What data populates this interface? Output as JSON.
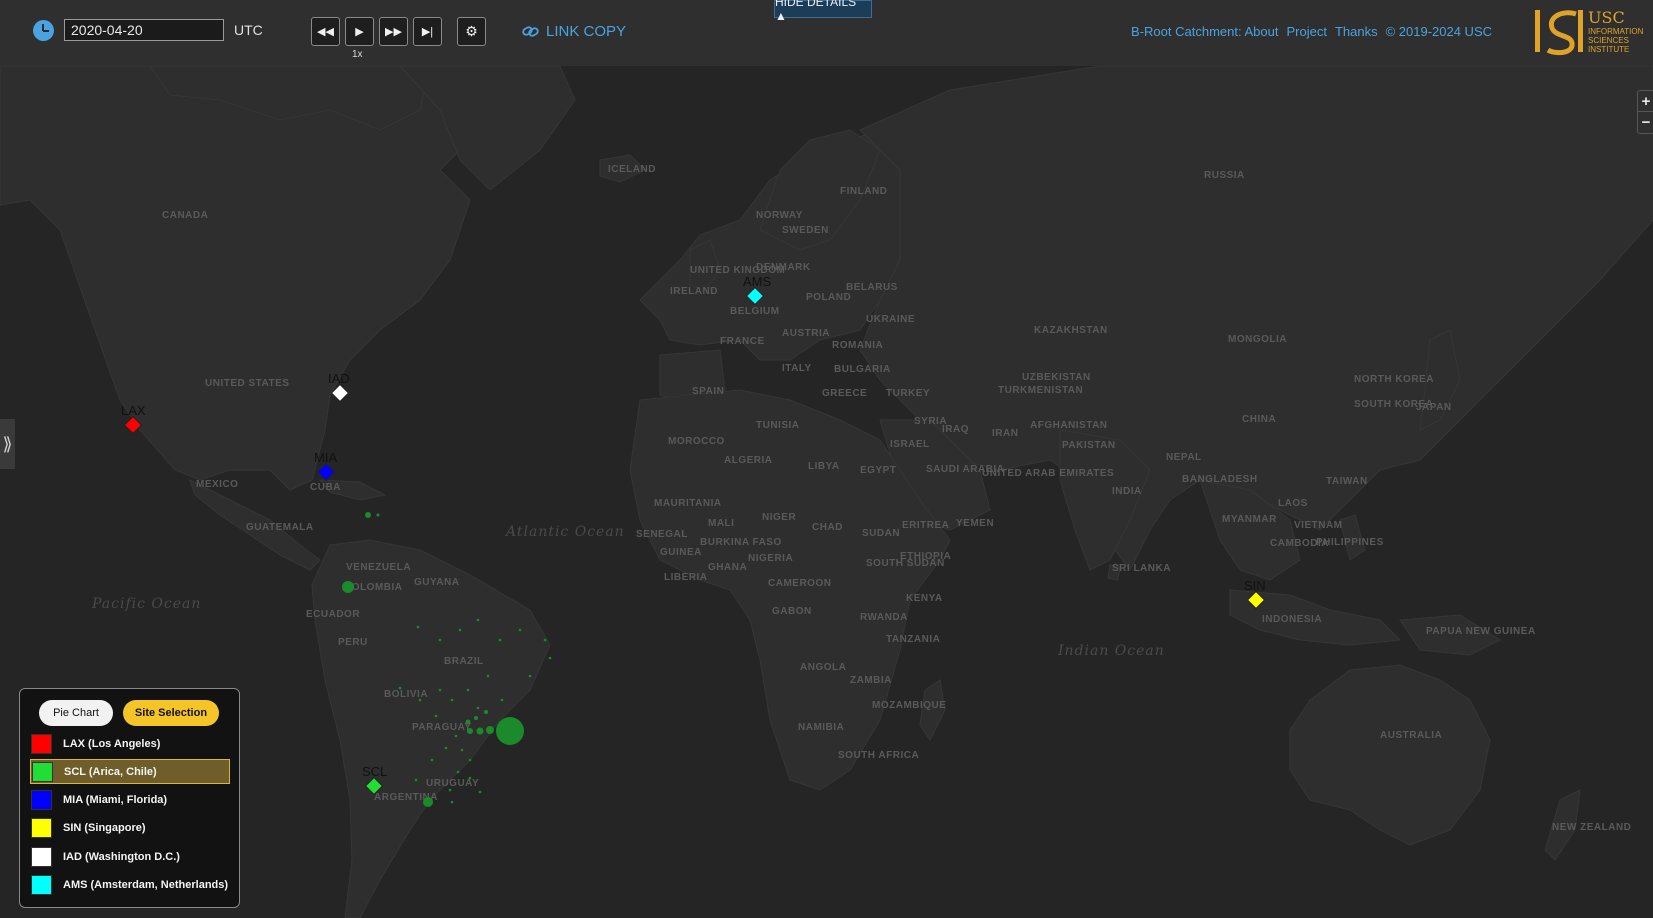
{
  "toolbar": {
    "date_value": "2020-04-20",
    "timezone": "UTC",
    "speed": "1x",
    "link_copy_label": "LINK COPY",
    "hide_details_label": "HIDE DETAILS ▲"
  },
  "header_links": {
    "about": "B-Root Catchment: About",
    "project": "Project",
    "thanks": "Thanks",
    "copyright": "© 2019-2024 USC"
  },
  "logo": {
    "usc": "USC",
    "institute_line1": "INFORMATION",
    "institute_line2": "SCIENCES",
    "institute_line3": "INSTITUTE"
  },
  "zoom": {
    "in": "+",
    "out": "−"
  },
  "map_labels": {
    "countries": [
      "ICELAND",
      "CANADA",
      "FINLAND",
      "NORWAY",
      "SWEDEN",
      "RUSSIA",
      "UNITED KINGDOM",
      "IRELAND",
      "DENMARK",
      "BELARUS",
      "POLAND",
      "BELGIUM",
      "FRANCE",
      "AUSTRIA",
      "UKRAINE",
      "ROMANIA",
      "KAZAKHSTAN",
      "MONGOLIA",
      "ITALY",
      "BULGARIA",
      "GREECE",
      "TURKEY",
      "SPAIN",
      "UZBEKISTAN",
      "TURKMENISTAN",
      "NORTH KOREA",
      "SOUTH KOREA",
      "JAPAN",
      "UNITED STATES",
      "TUNISIA",
      "SYRIA",
      "IRAQ",
      "IRAN",
      "AFGHANISTAN",
      "CHINA",
      "MOROCCO",
      "ISRAEL",
      "PAKISTAN",
      "ALGERIA",
      "LIBYA",
      "EGYPT",
      "SAUDI ARABIA",
      "NEPAL",
      "MEXICO",
      "UNITED ARAB EMIRATES",
      "INDIA",
      "BANGLADESH",
      "TAIWAN",
      "CUBA",
      "MAURITANIA",
      "MALI",
      "NIGER",
      "CHAD",
      "SUDAN",
      "ERITREA",
      "YEMEN",
      "MYANMAR",
      "LAOS",
      "VIETNAM",
      "GUATEMALA",
      "SENEGAL",
      "GUINEA",
      "BURKINA FASO",
      "NIGERIA",
      "ETHIOPIA",
      "SOUTH SUDAN",
      "PHILIPPINES",
      "CAMBODIA",
      "VENEZUELA",
      "GUYANA",
      "LIBERIA",
      "GHANA",
      "CAMEROON",
      "SRI LANKA",
      "COLOMBIA",
      "GABON",
      "KENYA",
      "ECUADOR",
      "RWANDA",
      "INDONESIA",
      "PAPUA NEW GUINEA",
      "PERU",
      "BRAZIL",
      "TANZANIA",
      "ANGOLA",
      "ZAMBIA",
      "BOLIVIA",
      "MOZAMBIQUE",
      "NAMIBIA",
      "PARAGUAY",
      "SOUTH AFRICA",
      "AUSTRALIA",
      "URUGUAY",
      "ARGENTINA",
      "NEW ZEALAND"
    ],
    "oceans": [
      "Atlantic Ocean",
      "Pacific Ocean",
      "Indian Ocean"
    ]
  },
  "sites": [
    {
      "code": "LAX",
      "name": "LAX (Los Angeles)",
      "color": "#ff0000"
    },
    {
      "code": "SCL",
      "name": "SCL (Arica, Chile)",
      "color": "#22dd33",
      "selected": true
    },
    {
      "code": "MIA",
      "name": "MIA (Miami, Florida)",
      "color": "#0000ff"
    },
    {
      "code": "SIN",
      "name": "SIN (Singapore)",
      "color": "#ffff00"
    },
    {
      "code": "IAD",
      "name": "IAD (Washington D.C.)",
      "color": "#ffffff"
    },
    {
      "code": "AMS",
      "name": "AMS (Amsterdam, Netherlands)",
      "color": "#00ffff"
    }
  ],
  "legend": {
    "pie_chart_label": "Pie Chart",
    "site_selection_label": "Site Selection"
  },
  "catchment_color": "#1b8a2a"
}
